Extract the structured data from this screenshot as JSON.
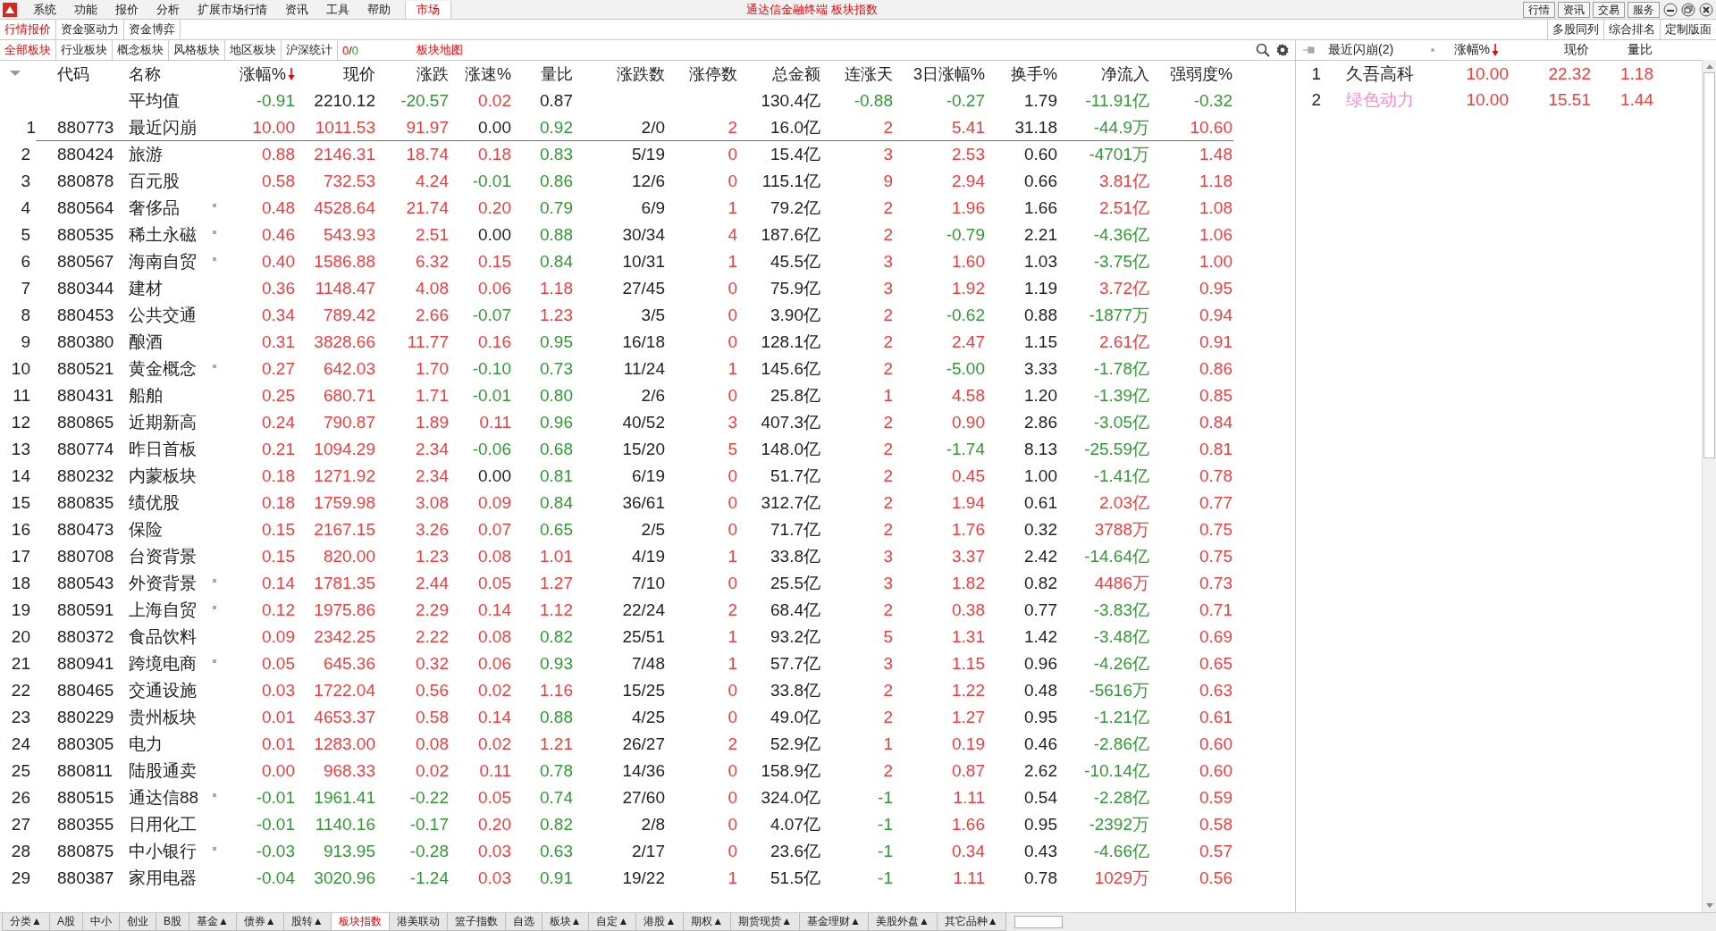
{
  "menu": {
    "items": [
      "系统",
      "功能",
      "报价",
      "分析",
      "扩展市场行情",
      "资讯",
      "工具",
      "帮助"
    ],
    "market_tab": "市场"
  },
  "window": {
    "title": "通达信金融终端 板块指数",
    "buttons": [
      "行情",
      "资讯",
      "交易",
      "服务"
    ]
  },
  "view_tabs": [
    {
      "label": "行情报价",
      "selected": true
    },
    {
      "label": "资金驱动力",
      "selected": false
    },
    {
      "label": "资金博弈",
      "selected": false
    }
  ],
  "layout_buttons": [
    "多股同列",
    "综合排名",
    "定制版面"
  ],
  "block_tabs": [
    {
      "label": "全部板块",
      "selected": true
    },
    {
      "label": "行业板块",
      "selected": false
    },
    {
      "label": "概念板块",
      "selected": false
    },
    {
      "label": "风格板块",
      "selected": false
    },
    {
      "label": "地区板块",
      "selected": false
    },
    {
      "label": "沪深统计",
      "selected": false
    }
  ],
  "up_down": {
    "up": "0",
    "sep": "/",
    "down": "0"
  },
  "map_link": "板块地图",
  "table": {
    "columns": [
      {
        "label": "代码",
        "sorted": false
      },
      {
        "label": "名称",
        "sorted": false
      },
      {
        "label": "涨幅%",
        "sorted": true
      },
      {
        "label": "现价",
        "sorted": false
      },
      {
        "label": "涨跌",
        "sorted": false
      },
      {
        "label": "涨速%",
        "sorted": false
      },
      {
        "label": "量比",
        "sorted": false
      },
      {
        "label": "涨跌数",
        "sorted": false
      },
      {
        "label": "涨停数",
        "sorted": false
      },
      {
        "label": "总金额",
        "sorted": false
      },
      {
        "label": "连涨天",
        "sorted": false
      },
      {
        "label": "3日涨幅%",
        "sorted": false
      },
      {
        "label": "换手%",
        "sorted": false
      },
      {
        "label": "净流入",
        "sorted": false
      },
      {
        "label": "强弱度%",
        "sorted": false
      }
    ],
    "rows": [
      {
        "kind": "average",
        "selected": false,
        "flag": false,
        "cells": [
          null,
          "平均值",
          "-0.91",
          "2210.12",
          "-20.57",
          "0.02",
          "0.87",
          null,
          null,
          "130.4亿",
          "-0.88",
          "-0.27",
          "1.79",
          "-11.91亿",
          "-0.32"
        ]
      },
      {
        "kind": "stock",
        "no": "1",
        "selected": true,
        "flag": false,
        "cells": [
          "880773",
          "最近闪崩",
          "10.00",
          "1011.53",
          "91.97",
          "0.00",
          "0.92",
          "2/0",
          "2",
          "16.0亿",
          "2",
          "5.41",
          "31.18",
          "-44.9万",
          "10.60"
        ]
      },
      {
        "kind": "stock",
        "no": "2",
        "selected": false,
        "flag": false,
        "cells": [
          "880424",
          "旅游",
          "0.88",
          "2146.31",
          "18.74",
          "0.18",
          "0.83",
          "5/19",
          "0",
          "15.4亿",
          "3",
          "2.53",
          "0.60",
          "-4701万",
          "1.48"
        ]
      },
      {
        "kind": "stock",
        "no": "3",
        "selected": false,
        "flag": false,
        "cells": [
          "880878",
          "百元股",
          "0.58",
          "732.53",
          "4.24",
          "-0.01",
          "0.86",
          "12/6",
          "0",
          "115.1亿",
          "9",
          "2.94",
          "0.66",
          "3.81亿",
          "1.18"
        ]
      },
      {
        "kind": "stock",
        "no": "4",
        "selected": false,
        "flag": true,
        "cells": [
          "880564",
          "奢侈品",
          "0.48",
          "4528.64",
          "21.74",
          "0.20",
          "0.79",
          "6/9",
          "1",
          "79.2亿",
          "2",
          "1.96",
          "1.66",
          "2.51亿",
          "1.08"
        ]
      },
      {
        "kind": "stock",
        "no": "5",
        "selected": false,
        "flag": true,
        "cells": [
          "880535",
          "稀土永磁",
          "0.46",
          "543.93",
          "2.51",
          "0.00",
          "0.88",
          "30/34",
          "4",
          "187.6亿",
          "2",
          "-0.79",
          "2.21",
          "-4.36亿",
          "1.06"
        ]
      },
      {
        "kind": "stock",
        "no": "6",
        "selected": false,
        "flag": true,
        "cells": [
          "880567",
          "海南自贸",
          "0.40",
          "1586.88",
          "6.32",
          "0.15",
          "0.84",
          "10/31",
          "1",
          "45.5亿",
          "3",
          "1.60",
          "1.03",
          "-3.75亿",
          "1.00"
        ]
      },
      {
        "kind": "stock",
        "no": "7",
        "selected": false,
        "flag": false,
        "cells": [
          "880344",
          "建材",
          "0.36",
          "1148.47",
          "4.08",
          "0.06",
          "1.18",
          "27/45",
          "0",
          "75.9亿",
          "3",
          "1.92",
          "1.19",
          "3.72亿",
          "0.95"
        ]
      },
      {
        "kind": "stock",
        "no": "8",
        "selected": false,
        "flag": false,
        "cells": [
          "880453",
          "公共交通",
          "0.34",
          "789.42",
          "2.66",
          "-0.07",
          "1.23",
          "3/5",
          "0",
          "3.90亿",
          "2",
          "-0.62",
          "0.88",
          "-1877万",
          "0.94"
        ]
      },
      {
        "kind": "stock",
        "no": "9",
        "selected": false,
        "flag": false,
        "cells": [
          "880380",
          "酿酒",
          "0.31",
          "3828.66",
          "11.77",
          "0.16",
          "0.95",
          "16/18",
          "0",
          "128.1亿",
          "2",
          "2.47",
          "1.15",
          "2.61亿",
          "0.91"
        ]
      },
      {
        "kind": "stock",
        "no": "10",
        "selected": false,
        "flag": true,
        "cells": [
          "880521",
          "黄金概念",
          "0.27",
          "642.03",
          "1.70",
          "-0.10",
          "0.73",
          "11/24",
          "1",
          "145.6亿",
          "2",
          "-5.00",
          "3.33",
          "-1.78亿",
          "0.86"
        ]
      },
      {
        "kind": "stock",
        "no": "11",
        "selected": false,
        "flag": false,
        "cells": [
          "880431",
          "船舶",
          "0.25",
          "680.71",
          "1.71",
          "-0.01",
          "0.80",
          "2/6",
          "0",
          "25.8亿",
          "1",
          "4.58",
          "1.20",
          "-1.39亿",
          "0.85"
        ]
      },
      {
        "kind": "stock",
        "no": "12",
        "selected": false,
        "flag": false,
        "cells": [
          "880865",
          "近期新高",
          "0.24",
          "790.87",
          "1.89",
          "0.11",
          "0.96",
          "40/52",
          "3",
          "407.3亿",
          "2",
          "0.90",
          "2.86",
          "-3.05亿",
          "0.84"
        ]
      },
      {
        "kind": "stock",
        "no": "13",
        "selected": false,
        "flag": false,
        "cells": [
          "880774",
          "昨日首板",
          "0.21",
          "1094.29",
          "2.34",
          "-0.06",
          "0.68",
          "15/20",
          "5",
          "148.0亿",
          "2",
          "-1.74",
          "8.13",
          "-25.59亿",
          "0.81"
        ]
      },
      {
        "kind": "stock",
        "no": "14",
        "selected": false,
        "flag": false,
        "cells": [
          "880232",
          "内蒙板块",
          "0.18",
          "1271.92",
          "2.34",
          "0.00",
          "0.81",
          "6/19",
          "0",
          "51.7亿",
          "2",
          "0.45",
          "1.00",
          "-1.41亿",
          "0.78"
        ]
      },
      {
        "kind": "stock",
        "no": "15",
        "selected": false,
        "flag": false,
        "cells": [
          "880835",
          "绩优股",
          "0.18",
          "1759.98",
          "3.08",
          "0.09",
          "0.84",
          "36/61",
          "0",
          "312.7亿",
          "2",
          "1.94",
          "0.61",
          "2.03亿",
          "0.77"
        ]
      },
      {
        "kind": "stock",
        "no": "16",
        "selected": false,
        "flag": false,
        "cells": [
          "880473",
          "保险",
          "0.15",
          "2167.15",
          "3.26",
          "0.07",
          "0.65",
          "2/5",
          "0",
          "71.7亿",
          "2",
          "1.76",
          "0.32",
          "3788万",
          "0.75"
        ]
      },
      {
        "kind": "stock",
        "no": "17",
        "selected": false,
        "flag": false,
        "cells": [
          "880708",
          "台资背景",
          "0.15",
          "820.00",
          "1.23",
          "0.08",
          "1.01",
          "4/19",
          "1",
          "33.8亿",
          "3",
          "3.37",
          "2.42",
          "-14.64亿",
          "0.75"
        ]
      },
      {
        "kind": "stock",
        "no": "18",
        "selected": false,
        "flag": true,
        "cells": [
          "880543",
          "外资背景",
          "0.14",
          "1781.35",
          "2.44",
          "0.05",
          "1.27",
          "7/10",
          "0",
          "25.5亿",
          "3",
          "1.82",
          "0.82",
          "4486万",
          "0.73"
        ]
      },
      {
        "kind": "stock",
        "no": "19",
        "selected": false,
        "flag": true,
        "cells": [
          "880591",
          "上海自贸",
          "0.12",
          "1975.86",
          "2.29",
          "0.14",
          "1.12",
          "22/24",
          "2",
          "68.4亿",
          "2",
          "0.38",
          "0.77",
          "-3.83亿",
          "0.71"
        ]
      },
      {
        "kind": "stock",
        "no": "20",
        "selected": false,
        "flag": false,
        "cells": [
          "880372",
          "食品饮料",
          "0.09",
          "2342.25",
          "2.22",
          "0.08",
          "0.82",
          "25/51",
          "1",
          "93.2亿",
          "5",
          "1.31",
          "1.42",
          "-3.48亿",
          "0.69"
        ]
      },
      {
        "kind": "stock",
        "no": "21",
        "selected": false,
        "flag": true,
        "cells": [
          "880941",
          "跨境电商",
          "0.05",
          "645.36",
          "0.32",
          "0.06",
          "0.93",
          "7/48",
          "1",
          "57.7亿",
          "3",
          "1.15",
          "0.96",
          "-4.26亿",
          "0.65"
        ]
      },
      {
        "kind": "stock",
        "no": "22",
        "selected": false,
        "flag": false,
        "cells": [
          "880465",
          "交通设施",
          "0.03",
          "1722.04",
          "0.56",
          "0.02",
          "1.16",
          "15/25",
          "0",
          "33.8亿",
          "2",
          "1.22",
          "0.48",
          "-5616万",
          "0.63"
        ]
      },
      {
        "kind": "stock",
        "no": "23",
        "selected": false,
        "flag": false,
        "cells": [
          "880229",
          "贵州板块",
          "0.01",
          "4653.37",
          "0.58",
          "0.14",
          "0.88",
          "4/25",
          "0",
          "49.0亿",
          "2",
          "1.27",
          "0.95",
          "-1.21亿",
          "0.61"
        ]
      },
      {
        "kind": "stock",
        "no": "24",
        "selected": false,
        "flag": false,
        "cells": [
          "880305",
          "电力",
          "0.01",
          "1283.00",
          "0.08",
          "0.02",
          "1.21",
          "26/27",
          "2",
          "52.9亿",
          "1",
          "0.19",
          "0.46",
          "-2.86亿",
          "0.60"
        ]
      },
      {
        "kind": "stock",
        "no": "25",
        "selected": false,
        "flag": false,
        "cells": [
          "880811",
          "陆股通卖",
          "0.00",
          "968.33",
          "0.02",
          "0.11",
          "0.78",
          "14/36",
          "0",
          "158.9亿",
          "2",
          "0.87",
          "2.62",
          "-10.14亿",
          "0.60"
        ]
      },
      {
        "kind": "stock",
        "no": "26",
        "selected": false,
        "flag": true,
        "cells": [
          "880515",
          "通达信88",
          "-0.01",
          "1961.41",
          "-0.22",
          "0.05",
          "0.74",
          "27/60",
          "0",
          "324.0亿",
          "-1",
          "1.11",
          "0.54",
          "-2.28亿",
          "0.59"
        ]
      },
      {
        "kind": "stock",
        "no": "27",
        "selected": false,
        "flag": false,
        "cells": [
          "880355",
          "日用化工",
          "-0.01",
          "1140.16",
          "-0.17",
          "0.20",
          "0.82",
          "2/8",
          "0",
          "4.07亿",
          "-1",
          "1.66",
          "0.95",
          "-2392万",
          "0.58"
        ]
      },
      {
        "kind": "stock",
        "no": "28",
        "selected": false,
        "flag": true,
        "cells": [
          "880875",
          "中小银行",
          "-0.03",
          "913.95",
          "-0.28",
          "0.03",
          "0.63",
          "2/17",
          "0",
          "23.6亿",
          "-1",
          "0.34",
          "0.43",
          "-4.66亿",
          "0.57"
        ]
      },
      {
        "kind": "stock",
        "no": "29",
        "selected": false,
        "flag": false,
        "cells": [
          "880387",
          "家用电器",
          "-0.04",
          "3020.96",
          "-1.24",
          "0.03",
          "0.91",
          "19/22",
          "1",
          "51.5亿",
          "-1",
          "1.11",
          "0.78",
          "1029万",
          "0.56"
        ]
      }
    ]
  },
  "side_panel": {
    "title": "最近闪崩(2)",
    "columns": [
      {
        "label": "涨幅%",
        "sorted": true
      },
      {
        "label": "现价",
        "sorted": false
      },
      {
        "label": "量比",
        "sorted": false
      }
    ],
    "rows": [
      {
        "no": "1",
        "name": "久吾高科",
        "color": "#222222",
        "cells": [
          "10.00",
          "22.32",
          "1.18"
        ]
      },
      {
        "no": "2",
        "name": "绿色动力",
        "color": "#ff88cc",
        "cells": [
          "10.00",
          "15.51",
          "1.44"
        ]
      }
    ]
  },
  "bottom_tabs": [
    {
      "label": "分类▲",
      "selected": false
    },
    {
      "label": "A股",
      "selected": false
    },
    {
      "label": "中小",
      "selected": false
    },
    {
      "label": "创业",
      "selected": false
    },
    {
      "label": "B股",
      "selected": false
    },
    {
      "label": "基金▲",
      "selected": false
    },
    {
      "label": "债券▲",
      "selected": false
    },
    {
      "label": "股转▲",
      "selected": false
    },
    {
      "label": "板块指数",
      "selected": true
    },
    {
      "label": "港美联动",
      "selected": false
    },
    {
      "label": "篮子指数",
      "selected": false
    },
    {
      "label": "自选",
      "selected": false
    },
    {
      "label": "板块▲",
      "selected": false
    },
    {
      "label": "自定▲",
      "selected": false
    },
    {
      "label": "港股▲",
      "selected": false
    },
    {
      "label": "期权▲",
      "selected": false
    },
    {
      "label": "期货现货▲",
      "selected": false
    },
    {
      "label": "基金理财▲",
      "selected": false
    },
    {
      "label": "美股外盘▲",
      "selected": false
    },
    {
      "label": "其它品种▲",
      "selected": false
    }
  ]
}
